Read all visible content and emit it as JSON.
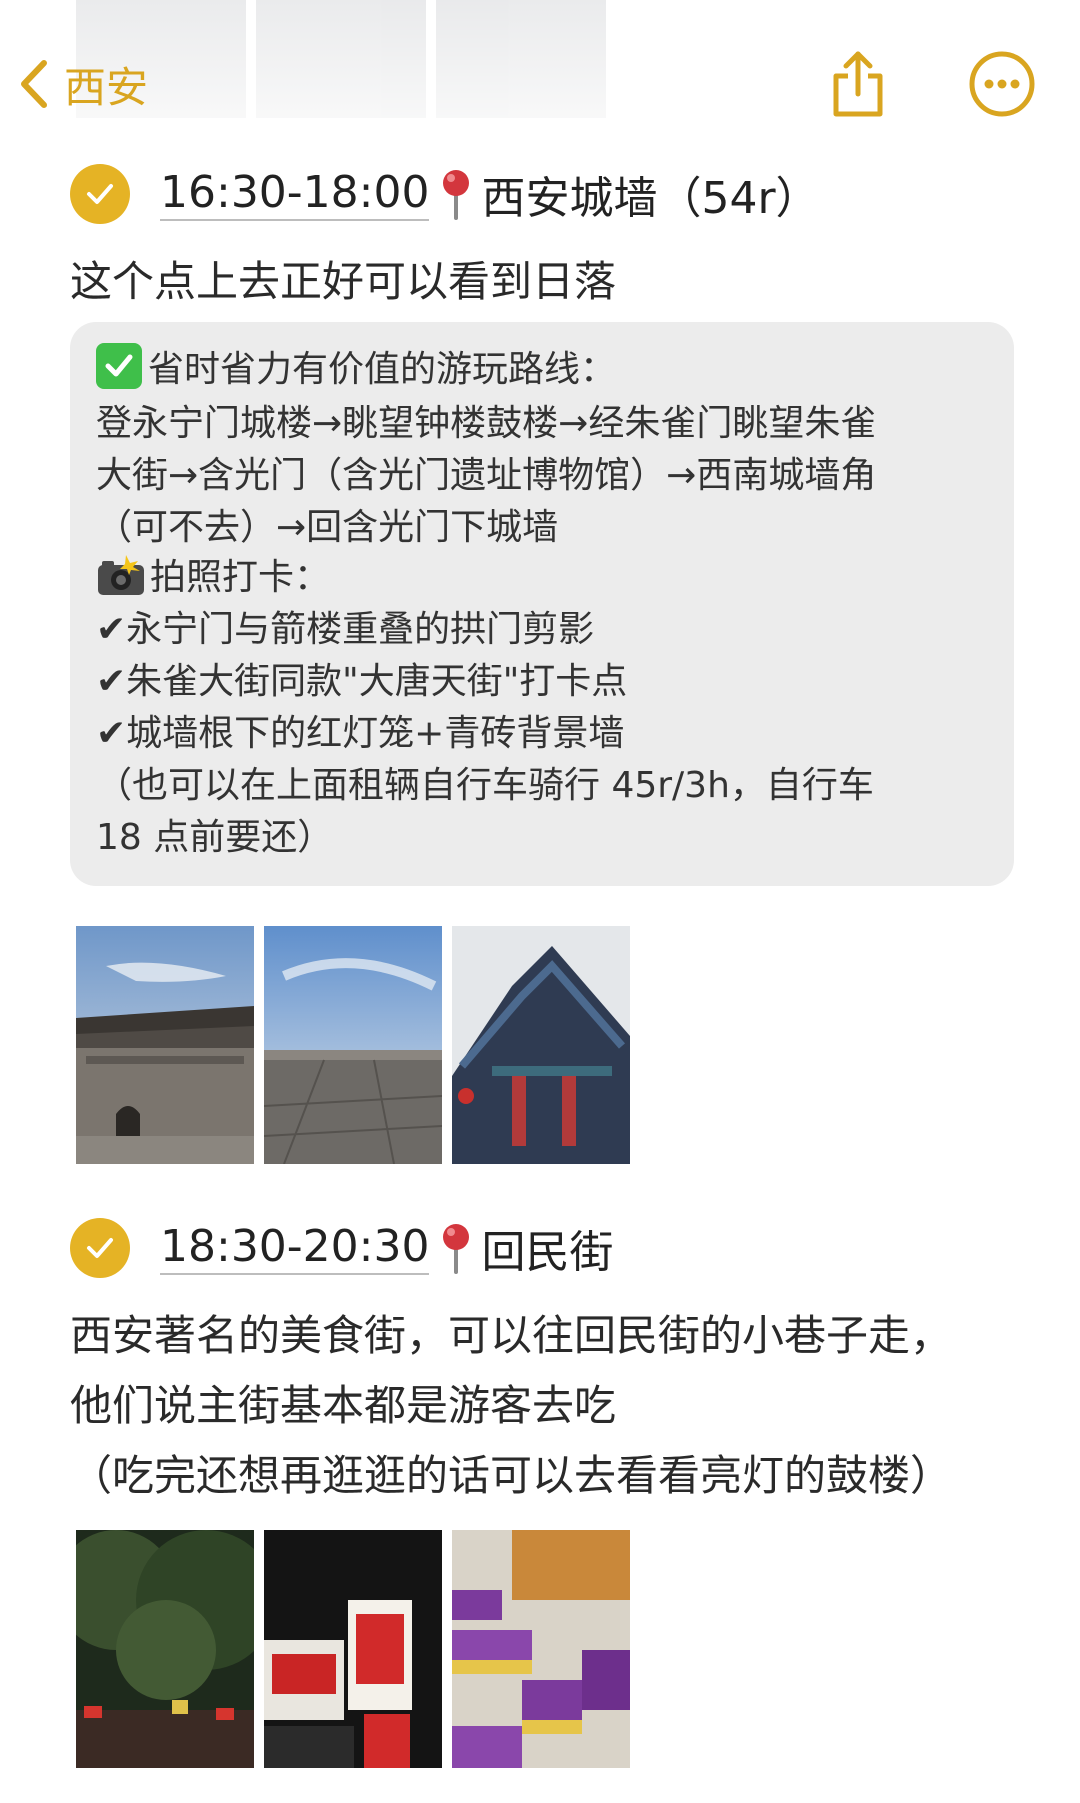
{
  "nav": {
    "back_label": "西安"
  },
  "entries": [
    {
      "time": "16:30-18:00",
      "place": "西安城墙（54r）",
      "description": "这个点上去正好可以看到日落",
      "note": {
        "route_title": "省时省力有价值的游玩路线：",
        "route_lines": [
          "登永宁门城楼→眺望钟楼鼓楼→经朱雀门眺望朱雀",
          "大街→含光门（含光门遗址博物馆）→西南城墙角",
          "（可不去）→回含光门下城墙"
        ],
        "photo_title": "拍照打卡：",
        "photo_spots": [
          "✔永宁门与箭楼重叠的拱门剪影",
          "✔朱雀大街同款\"大唐天街\"打卡点",
          "✔城墙根下的红灯笼+青砖背景墙"
        ],
        "tips": [
          "（也可以在上面租辆自行车骑行 45r/3h，自行车",
          " 18 点前要还）"
        ]
      }
    },
    {
      "time": "18:30-20:30",
      "place": "回民街",
      "description_lines": [
        "西安著名的美食街，可以往回民街的小巷子走，",
        "他们说主街基本都是游客去吃",
        "（吃完还想再逛逛的话可以去看看亮灯的鼓楼）"
      ]
    }
  ],
  "colors": {
    "accent": "#e5b325",
    "nav_tint": "#d9a520",
    "quote_bg": "#ececec",
    "pin_red": "#d3363d"
  },
  "icons": {
    "back": "chevron-left-icon",
    "share": "share-icon",
    "more": "more-icon",
    "check": "checkmark-circle-icon",
    "pin": "map-pin-icon",
    "check_emoji": "check-box-emoji",
    "camera_emoji": "camera-flash-emoji"
  }
}
